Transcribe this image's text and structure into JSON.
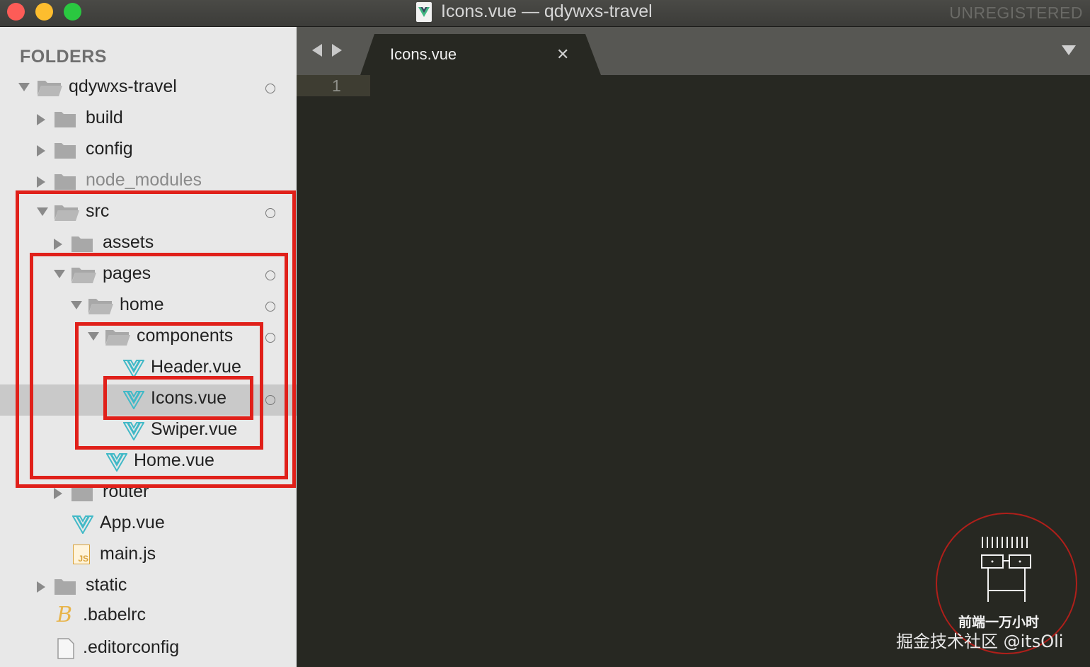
{
  "window": {
    "title": "Icons.vue — qdywxs-travel",
    "license_status": "UNREGISTERED"
  },
  "sidebar": {
    "heading": "FOLDERS",
    "tree": [
      {
        "label": "qdywxs-travel",
        "type": "folder-open",
        "expanded": true,
        "dot": true
      },
      {
        "label": "build",
        "type": "folder",
        "expanded": false
      },
      {
        "label": "config",
        "type": "folder",
        "expanded": false
      },
      {
        "label": "node_modules",
        "type": "folder",
        "expanded": false,
        "dimmed": true
      },
      {
        "label": "src",
        "type": "folder-open",
        "expanded": true,
        "dot": true
      },
      {
        "label": "assets",
        "type": "folder",
        "expanded": false
      },
      {
        "label": "pages",
        "type": "folder-open",
        "expanded": true,
        "dot": true
      },
      {
        "label": "home",
        "type": "folder-open",
        "expanded": true,
        "dot": true
      },
      {
        "label": "components",
        "type": "folder-open",
        "expanded": true,
        "dot": true
      },
      {
        "label": "Header.vue",
        "type": "vue-file"
      },
      {
        "label": "Icons.vue",
        "type": "vue-file",
        "selected": true,
        "dot": true
      },
      {
        "label": "Swiper.vue",
        "type": "vue-file"
      },
      {
        "label": "Home.vue",
        "type": "vue-file"
      },
      {
        "label": "router",
        "type": "folder",
        "expanded": false
      },
      {
        "label": "App.vue",
        "type": "vue-file"
      },
      {
        "label": "main.js",
        "type": "js-file",
        "icon_text": "JS"
      },
      {
        "label": "static",
        "type": "folder",
        "expanded": false
      },
      {
        "label": ".babelrc",
        "type": "babel-file",
        "icon_text": "B"
      },
      {
        "label": ".editorconfig",
        "type": "plain-file"
      }
    ]
  },
  "editor": {
    "active_tab": "Icons.vue",
    "close_glyph": "✕",
    "line_numbers": [
      "1"
    ]
  },
  "watermark": {
    "badge_text": "前端一万小时",
    "credit": "掘金技术社区 @itsOli"
  },
  "colors": {
    "highlight_box": "#e0201a",
    "vue_icon": "#41b9c7",
    "sidebar_bg": "#e8e8e8",
    "editor_bg": "#272822"
  }
}
